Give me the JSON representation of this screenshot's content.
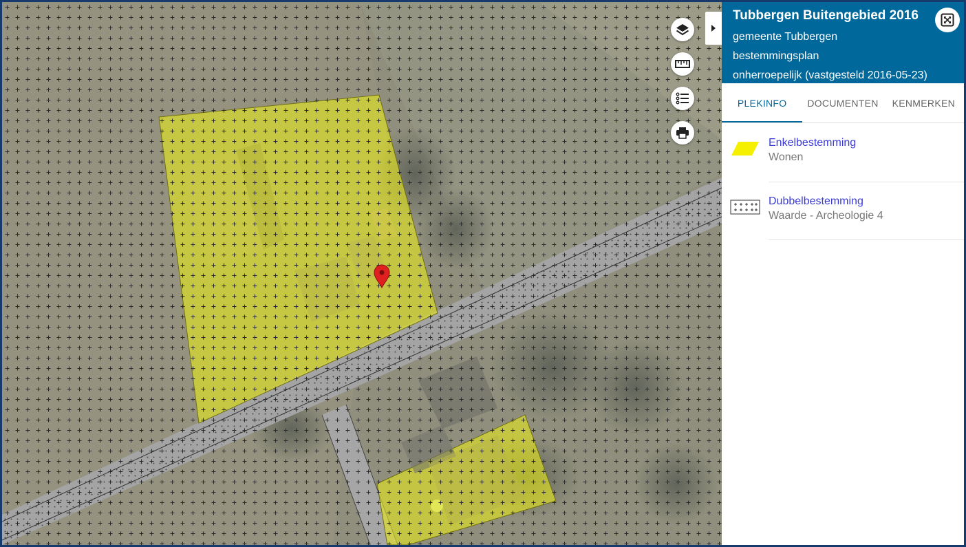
{
  "map": {
    "pattern_color": "#2a2a2a",
    "zone_fill": "#e7ea1a",
    "marker_color": "#e02020",
    "controls": [
      {
        "name": "layers-button",
        "icon": "layers-icon"
      },
      {
        "name": "measure-button",
        "icon": "ruler-icon"
      },
      {
        "name": "legend-button",
        "icon": "list-icon"
      },
      {
        "name": "print-button",
        "icon": "printer-icon"
      }
    ]
  },
  "panel": {
    "title": "Tubbergen Buitengebied 2016",
    "municipality": "gemeente Tubbergen",
    "plan_type": "bestemmingsplan",
    "status": "onherroepelijk (vastgesteld 2016-05-23)",
    "header_color": "#01689b",
    "fullscreen_icon": "fullscreen-icon",
    "tabs": [
      {
        "label": "PLEKINFO",
        "active": true
      },
      {
        "label": "DOCUMENTEN",
        "active": false
      },
      {
        "label": "KENMERKEN",
        "active": false
      }
    ],
    "items": [
      {
        "title": "Enkelbestemming",
        "subtitle": "Wonen",
        "legend": "yellow-parallelogram-icon"
      },
      {
        "title": "Dubbelbestemming",
        "subtitle": "Waarde - Archeologie 4",
        "legend": "cross-hatch-icon"
      }
    ]
  }
}
